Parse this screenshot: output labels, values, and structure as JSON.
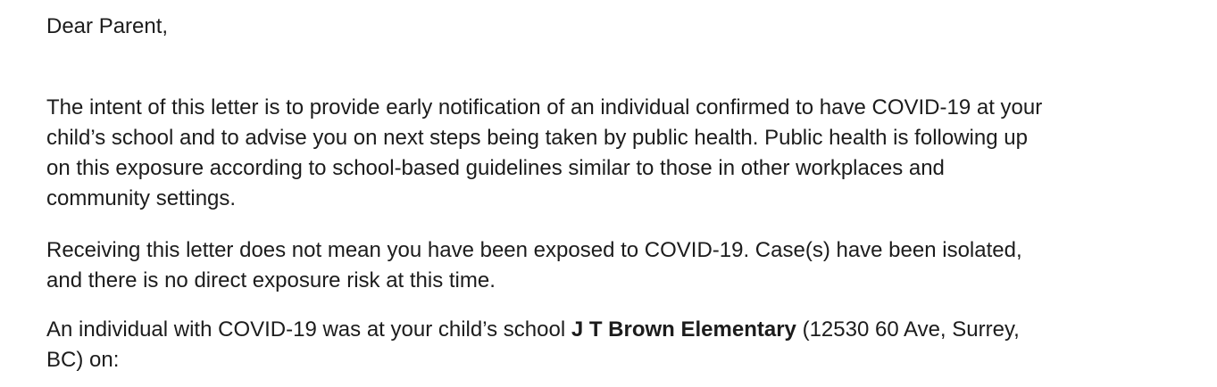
{
  "letter": {
    "greeting": "Dear Parent,",
    "paragraph1": {
      "lines": [
        "The intent of this letter is to provide early notification of an individual confirmed to have COVID-19 at your",
        "child’s school and to advise you on next steps being taken by public health. Public health is following up",
        "on this exposure according to school-based guidelines similar to those in other workplaces and",
        "community settings."
      ]
    },
    "paragraph2": {
      "lines": [
        "Receiving this letter does not mean you have been exposed to COVID-19. Case(s) have been isolated,",
        "and there is no direct exposure risk at this time."
      ]
    },
    "paragraph3": {
      "line1_prefix": "An individual with COVID-19 was at your child’s school ",
      "school_name": "J T Brown Elementary",
      "line1_suffix": " (12530 60 Ave, Surrey,",
      "line2": "BC) on:"
    }
  }
}
